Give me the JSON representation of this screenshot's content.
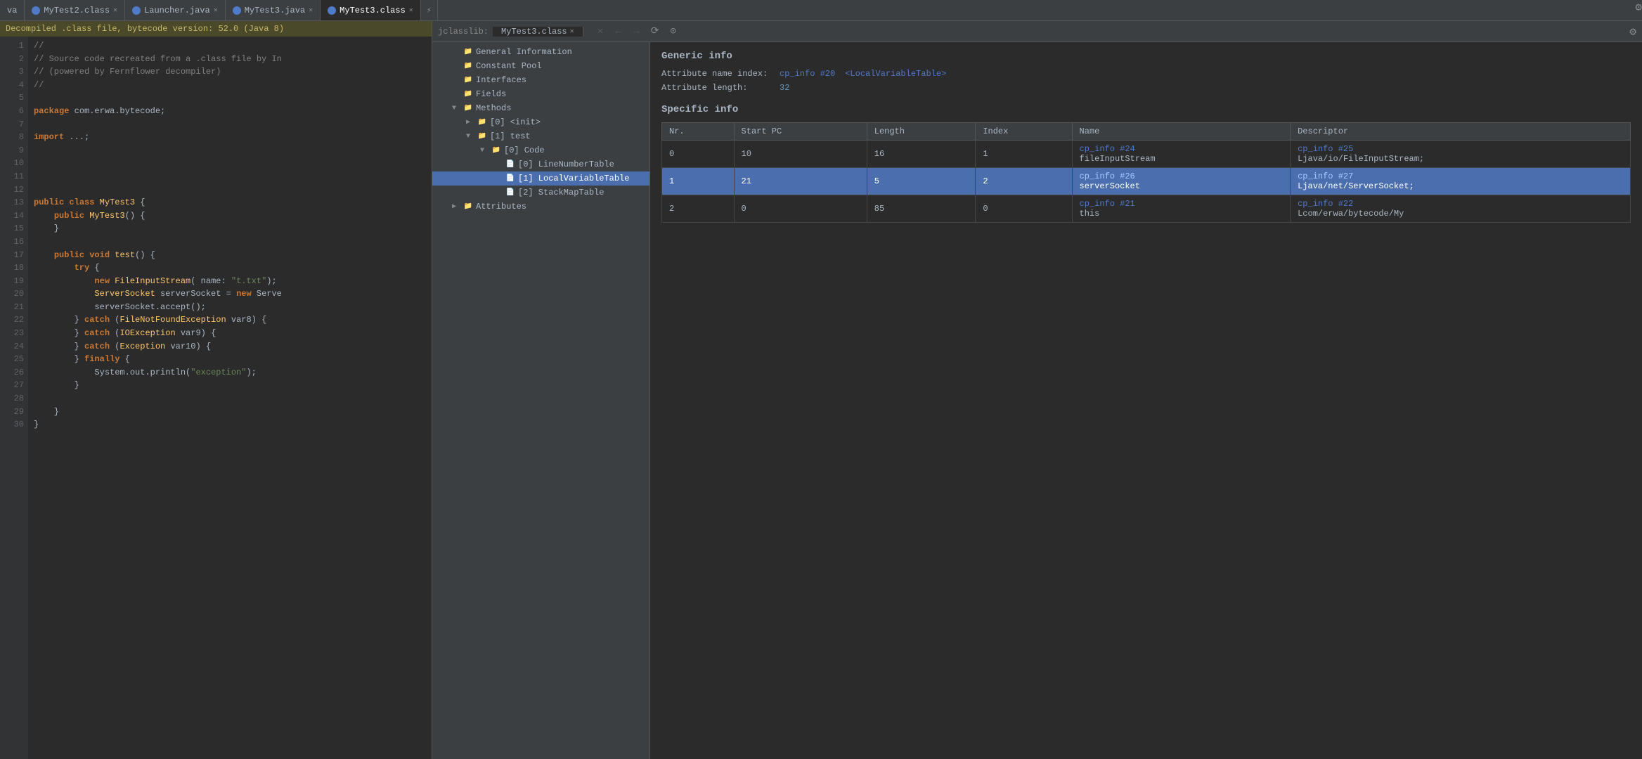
{
  "tabs": [
    {
      "id": "va",
      "label": "va",
      "icon_color": "#888",
      "active": false,
      "closable": false
    },
    {
      "id": "mytest2",
      "label": "MyTest2.class",
      "icon_color": "#4e7aca",
      "active": false,
      "closable": true
    },
    {
      "id": "launcher",
      "label": "Launcher.java",
      "icon_color": "#4e7aca",
      "active": false,
      "closable": true
    },
    {
      "id": "mytest3-java",
      "label": "MyTest3.java",
      "icon_color": "#4e7aca",
      "active": false,
      "closable": true
    },
    {
      "id": "mytest3-class",
      "label": "MyTest3.class",
      "icon_color": "#4e7aca",
      "active": true,
      "closable": true
    },
    {
      "id": "group-icon",
      "label": "⚡",
      "icon_color": "#888",
      "active": false,
      "closable": false
    }
  ],
  "decompile_banner": "Decompiled .class file, bytecode version: 52.0 (Java 8)",
  "jclasslib": {
    "title": "jclasslib:",
    "tab_label": "MyTest3.class",
    "header_nav": [
      "✕",
      "←",
      "→",
      "⟳",
      "⊙"
    ]
  },
  "code": {
    "lines": [
      {
        "num": 1,
        "text": "//",
        "tokens": [
          {
            "t": "comment",
            "v": "//"
          }
        ]
      },
      {
        "num": 2,
        "text": "// Source code recreated from a .class file by In",
        "tokens": [
          {
            "t": "comment",
            "v": "// Source code recreated from a .class file by In"
          }
        ]
      },
      {
        "num": 3,
        "text": "// (powered by Fernflower decompiler)",
        "tokens": [
          {
            "t": "comment",
            "v": "// (powered by Fernflower decompiler)"
          }
        ]
      },
      {
        "num": 4,
        "text": "//",
        "tokens": [
          {
            "t": "comment",
            "v": "//"
          }
        ]
      },
      {
        "num": 5,
        "text": "",
        "tokens": []
      },
      {
        "num": 6,
        "text": "package com.erwa.bytecode;",
        "tokens": [
          {
            "t": "kw",
            "v": "package"
          },
          {
            "t": "plain",
            "v": " com.erwa.bytecode;"
          }
        ]
      },
      {
        "num": 7,
        "text": "",
        "tokens": []
      },
      {
        "num": 8,
        "text": "import ...;",
        "tokens": [
          {
            "t": "kw",
            "v": "import"
          },
          {
            "t": "plain",
            "v": " ..."
          }
        ]
      },
      {
        "num": 9,
        "text": "",
        "tokens": []
      },
      {
        "num": 10,
        "text": "",
        "tokens": []
      },
      {
        "num": 11,
        "text": "",
        "tokens": []
      },
      {
        "num": 12,
        "text": "",
        "tokens": []
      },
      {
        "num": 13,
        "text": "public class MyTest3 {",
        "tokens": [
          {
            "t": "kw",
            "v": "public"
          },
          {
            "t": "plain",
            "v": " "
          },
          {
            "t": "kw",
            "v": "class"
          },
          {
            "t": "plain",
            "v": " "
          },
          {
            "t": "cls",
            "v": "MyTest3"
          },
          {
            "t": "plain",
            "v": " {"
          }
        ]
      },
      {
        "num": 14,
        "text": "    public MyTest3() {",
        "tokens": [
          {
            "t": "kw",
            "v": "    public"
          },
          {
            "t": "plain",
            "v": " "
          },
          {
            "t": "cls",
            "v": "MyTest3"
          },
          {
            "t": "plain",
            "v": "() {"
          }
        ]
      },
      {
        "num": 15,
        "text": "    }",
        "tokens": [
          {
            "t": "plain",
            "v": "    }"
          }
        ]
      },
      {
        "num": 16,
        "text": "",
        "tokens": []
      },
      {
        "num": 17,
        "text": "    public void test() {",
        "tokens": [
          {
            "t": "kw",
            "v": "    public"
          },
          {
            "t": "plain",
            "v": " "
          },
          {
            "t": "kw",
            "v": "void"
          },
          {
            "t": "plain",
            "v": " "
          },
          {
            "t": "method",
            "v": "test"
          },
          {
            "t": "plain",
            "v": "() {"
          }
        ]
      },
      {
        "num": 18,
        "text": "        try {",
        "tokens": [
          {
            "t": "kw",
            "v": "        try"
          },
          {
            "t": "plain",
            "v": " {"
          }
        ]
      },
      {
        "num": 19,
        "text": "            new FileInputStream( name: \"t.txt\");",
        "tokens": [
          {
            "t": "plain",
            "v": "            "
          },
          {
            "t": "kw",
            "v": "new"
          },
          {
            "t": "plain",
            "v": " "
          },
          {
            "t": "cls",
            "v": "FileInputStream"
          },
          {
            "t": "plain",
            "v": "( name: "
          },
          {
            "t": "str",
            "v": "\"t.txt\""
          },
          {
            "t": "plain",
            "v": ");"
          }
        ]
      },
      {
        "num": 20,
        "text": "            ServerSocket serverSocket = new Serve",
        "tokens": [
          {
            "t": "cls",
            "v": "            ServerSocket"
          },
          {
            "t": "plain",
            "v": " serverSocket = "
          },
          {
            "t": "kw",
            "v": "new"
          },
          {
            "t": "plain",
            "v": " Serve"
          }
        ]
      },
      {
        "num": 21,
        "text": "            serverSocket.accept();",
        "tokens": [
          {
            "t": "plain",
            "v": "            serverSocket.accept();"
          }
        ]
      },
      {
        "num": 22,
        "text": "        } catch (FileNotFoundException var8) {",
        "tokens": [
          {
            "t": "plain",
            "v": "        } "
          },
          {
            "t": "kw",
            "v": "catch"
          },
          {
            "t": "plain",
            "v": " ("
          },
          {
            "t": "cls",
            "v": "FileNotFoundException"
          },
          {
            "t": "plain",
            "v": " var8) {"
          }
        ]
      },
      {
        "num": 23,
        "text": "        } catch (IOException var9) {",
        "tokens": [
          {
            "t": "plain",
            "v": "        } "
          },
          {
            "t": "kw",
            "v": "catch"
          },
          {
            "t": "plain",
            "v": " ("
          },
          {
            "t": "cls",
            "v": "IOException"
          },
          {
            "t": "plain",
            "v": " var9) {"
          }
        ]
      },
      {
        "num": 24,
        "text": "        } catch (Exception var10) {",
        "tokens": [
          {
            "t": "plain",
            "v": "        } "
          },
          {
            "t": "kw",
            "v": "catch"
          },
          {
            "t": "plain",
            "v": " ("
          },
          {
            "t": "cls",
            "v": "Exception"
          },
          {
            "t": "plain",
            "v": " var10) {"
          }
        ]
      },
      {
        "num": 25,
        "text": "        } finally {",
        "tokens": [
          {
            "t": "plain",
            "v": "        } "
          },
          {
            "t": "kw",
            "v": "finally"
          },
          {
            "t": "plain",
            "v": " {"
          }
        ]
      },
      {
        "num": 26,
        "text": "            System.out.println(\"exception\");",
        "tokens": [
          {
            "t": "plain",
            "v": "            System.out.println("
          },
          {
            "t": "str",
            "v": "\"exception\""
          },
          {
            "t": "plain",
            "v": ");"
          }
        ]
      },
      {
        "num": 27,
        "text": "        }",
        "tokens": [
          {
            "t": "plain",
            "v": "        }"
          }
        ]
      },
      {
        "num": 28,
        "text": "",
        "tokens": []
      },
      {
        "num": 29,
        "text": "    }",
        "tokens": [
          {
            "t": "plain",
            "v": "    }"
          }
        ]
      },
      {
        "num": 30,
        "text": "}",
        "tokens": [
          {
            "t": "plain",
            "v": "}"
          }
        ]
      }
    ]
  },
  "tree": {
    "items": [
      {
        "id": "general",
        "label": "General Information",
        "indent": 0,
        "arrow": "",
        "folder": true,
        "selected": false
      },
      {
        "id": "constant-pool",
        "label": "Constant Pool",
        "indent": 0,
        "arrow": "",
        "folder": true,
        "selected": false
      },
      {
        "id": "interfaces",
        "label": "Interfaces",
        "indent": 0,
        "arrow": "",
        "folder": true,
        "selected": false
      },
      {
        "id": "fields",
        "label": "Fields",
        "indent": 0,
        "arrow": "",
        "folder": true,
        "selected": false
      },
      {
        "id": "methods",
        "label": "Methods",
        "indent": 0,
        "arrow": "▼",
        "folder": true,
        "selected": false
      },
      {
        "id": "methods-init",
        "label": "[0] <init>",
        "indent": 1,
        "arrow": "▶",
        "folder": true,
        "selected": false
      },
      {
        "id": "methods-test",
        "label": "[1] test",
        "indent": 1,
        "arrow": "▼",
        "folder": true,
        "selected": false
      },
      {
        "id": "methods-test-code",
        "label": "[0] Code",
        "indent": 2,
        "arrow": "▼",
        "folder": true,
        "selected": false
      },
      {
        "id": "methods-test-code-lnt",
        "label": "[0] LineNumberTable",
        "indent": 3,
        "arrow": "",
        "folder": false,
        "selected": false
      },
      {
        "id": "methods-test-code-lvt",
        "label": "[1] LocalVariableTable",
        "indent": 3,
        "arrow": "",
        "folder": false,
        "selected": true
      },
      {
        "id": "methods-test-code-smt",
        "label": "[2] StackMapTable",
        "indent": 3,
        "arrow": "",
        "folder": false,
        "selected": false
      },
      {
        "id": "attributes",
        "label": "Attributes",
        "indent": 0,
        "arrow": "▶",
        "folder": true,
        "selected": false
      }
    ]
  },
  "detail": {
    "generic_title": "Generic info",
    "attr_name_label": "Attribute name index:",
    "attr_name_value": "cp_info #20",
    "attr_name_suffix": "<LocalVariableTable>",
    "attr_length_label": "Attribute length:",
    "attr_length_value": "32",
    "specific_title": "Specific info",
    "table": {
      "columns": [
        "Nr.",
        "Start PC",
        "Length",
        "Index",
        "Name",
        "Descriptor"
      ],
      "rows": [
        {
          "nr": "0",
          "start_pc": "10",
          "length": "16",
          "index": "1",
          "name_link": "cp_info #24",
          "name_plain": "fileInputStream",
          "desc_link": "cp_info #25",
          "desc_plain": "Ljava/io/FileInputStream;",
          "selected": false
        },
        {
          "nr": "1",
          "start_pc": "21",
          "length": "5",
          "index": "2",
          "name_link": "cp_info #26",
          "name_plain": "serverSocket",
          "desc_link": "cp_info #27",
          "desc_plain": "Ljava/net/ServerSocket;",
          "selected": true
        },
        {
          "nr": "2",
          "start_pc": "0",
          "length": "85",
          "index": "0",
          "name_link": "cp_info #21",
          "name_plain": "this",
          "desc_link": "cp_info #22",
          "desc_plain": "Lcom/erwa/bytecode/My",
          "selected": false
        }
      ]
    }
  }
}
